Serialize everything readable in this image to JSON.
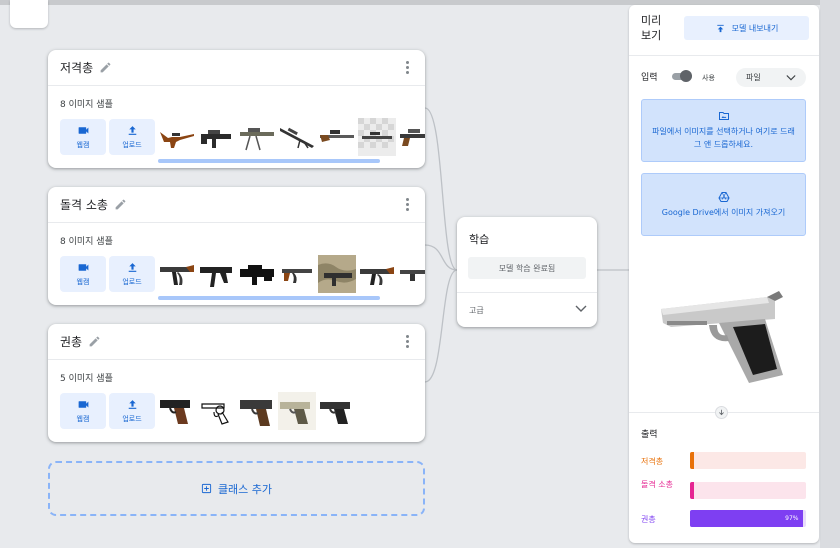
{
  "classes": [
    {
      "name": "저격총",
      "sample_count": "8 이미지 샘플",
      "webcam_label": "웹캠",
      "upload_label": "업로드",
      "thumbnails": [
        "rifle-thumbnail",
        "rifle-thumbnail",
        "rifle-thumbnail",
        "rifle-thumbnail",
        "rifle-thumbnail",
        "rifle-thumbnail",
        "rifle-thumbnail"
      ]
    },
    {
      "name": "돌격 소총",
      "sample_count": "8 이미지 샘플",
      "webcam_label": "웹캠",
      "upload_label": "업로드",
      "thumbnails": [
        "assault-rifle-thumbnail",
        "assault-rifle-thumbnail",
        "assault-rifle-thumbnail",
        "assault-rifle-thumbnail",
        "assault-rifle-thumbnail",
        "assault-rifle-thumbnail",
        "assault-rifle-thumbnail"
      ]
    },
    {
      "name": "권총",
      "sample_count": "5 이미지 샘플",
      "webcam_label": "웹캠",
      "upload_label": "업로드",
      "thumbnails": [
        "pistol-thumbnail",
        "revolver-thumbnail",
        "pistol-thumbnail",
        "pistol-thumbnail",
        "pistol-thumbnail"
      ]
    }
  ],
  "add_class_label": "클래스 추가",
  "training": {
    "title": "학습",
    "button_label": "모델 학습 완료됨",
    "advanced_label": "고급"
  },
  "preview": {
    "title": "미리 보기",
    "export_label": "모델 내보내기",
    "input_label": "입력",
    "toggle_label": "사용",
    "input_source": "파일",
    "file_drop_text": "파일에서 이미지를 선택하거나 여기로 드래그 앤 드롭하세요.",
    "drive_text": "Google Drive에서 이미지 가져오기",
    "output_label": "출력",
    "outputs": [
      {
        "label": "저격총",
        "percent": 1,
        "text": "",
        "color": "#e8710a",
        "bg": "#fce8e6"
      },
      {
        "label": "돌격 소총",
        "percent": 1,
        "text": "",
        "color": "#e52592",
        "bg": "#fce4ec"
      },
      {
        "label": "권총",
        "percent": 97,
        "text": "97%",
        "color": "#7e3ff2",
        "bg": "#e9ddfb"
      }
    ]
  }
}
